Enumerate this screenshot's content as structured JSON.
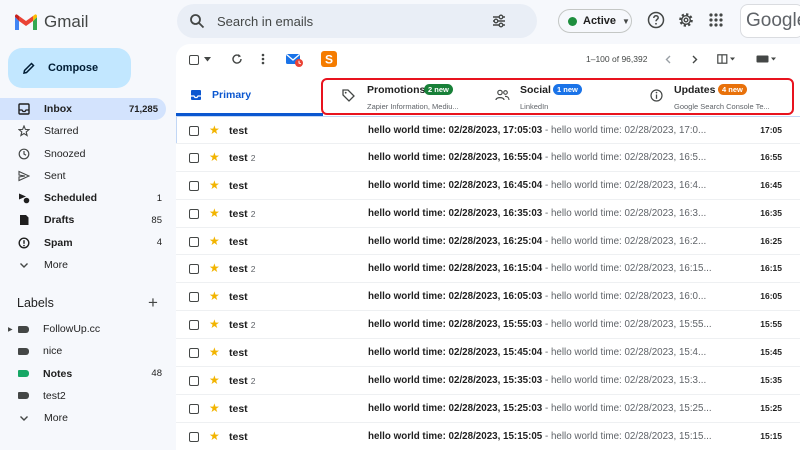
{
  "app": {
    "name": "Gmail"
  },
  "search": {
    "placeholder": "Search in emails"
  },
  "status": {
    "label": "Active"
  },
  "header": {
    "google_text": "Google"
  },
  "sidebar": {
    "compose_label": "Compose",
    "items": [
      {
        "label": "Inbox",
        "count": "71,285",
        "bold": true,
        "icon": "inbox-icon"
      },
      {
        "label": "Starred",
        "count": "",
        "bold": false,
        "icon": "star-icon"
      },
      {
        "label": "Snoozed",
        "count": "",
        "bold": false,
        "icon": "clock-icon"
      },
      {
        "label": "Sent",
        "count": "",
        "bold": false,
        "icon": "send-icon"
      },
      {
        "label": "Scheduled",
        "count": "1",
        "bold": true,
        "icon": "scheduled-icon"
      },
      {
        "label": "Drafts",
        "count": "85",
        "bold": true,
        "icon": "draft-icon"
      },
      {
        "label": "Spam",
        "count": "4",
        "bold": true,
        "icon": "spam-icon"
      },
      {
        "label": "More",
        "count": "",
        "bold": false,
        "icon": "chevron-down-icon"
      }
    ],
    "labels_heading": "Labels",
    "labels": [
      {
        "label": "FollowUp.cc",
        "count": "",
        "color": "#444746",
        "bold": false,
        "expander": true
      },
      {
        "label": "nice",
        "count": "",
        "color": "#444746",
        "bold": false,
        "expander": false
      },
      {
        "label": "Notes",
        "count": "48",
        "color": "#16a765",
        "bold": true,
        "expander": false
      },
      {
        "label": "test2",
        "count": "",
        "color": "#444746",
        "bold": false,
        "expander": false
      },
      {
        "label": "More",
        "count": "",
        "color": "",
        "bold": false,
        "expander": false
      }
    ]
  },
  "toolbar": {
    "pagination": "1–100 of 96,392"
  },
  "tabs": {
    "primary": "Primary",
    "promotions": {
      "name": "Promotions",
      "badge": "2 new",
      "sub": "Zapier Information, Mediu...",
      "color": "#188038"
    },
    "social": {
      "name": "Social",
      "badge": "1 new",
      "sub": "LinkedIn",
      "color": "#1a73e8"
    },
    "updates": {
      "name": "Updates",
      "badge": "4 new",
      "sub": "Google Search Console Te...",
      "color": "#e8710a"
    }
  },
  "emails": [
    {
      "sender": "test",
      "count": "",
      "subject": "hello world time: 02/28/2023, 17:05:03",
      "snippet": " - hello world time: 02/28/2023, 17:0...",
      "time": "17:05"
    },
    {
      "sender": "test",
      "count": "2",
      "subject": "hello world time: 02/28/2023, 16:55:04",
      "snippet": " - hello world time: 02/28/2023, 16:5...",
      "time": "16:55"
    },
    {
      "sender": "test",
      "count": "",
      "subject": "hello world time: 02/28/2023, 16:45:04",
      "snippet": " - hello world time: 02/28/2023, 16:4...",
      "time": "16:45"
    },
    {
      "sender": "test",
      "count": "2",
      "subject": "hello world time: 02/28/2023, 16:35:03",
      "snippet": " - hello world time: 02/28/2023, 16:3...",
      "time": "16:35"
    },
    {
      "sender": "test",
      "count": "",
      "subject": "hello world time: 02/28/2023, 16:25:04",
      "snippet": " - hello world time: 02/28/2023, 16:2...",
      "time": "16:25"
    },
    {
      "sender": "test",
      "count": "2",
      "subject": "hello world time: 02/28/2023, 16:15:04",
      "snippet": " - hello world time: 02/28/2023, 16:15...",
      "time": "16:15"
    },
    {
      "sender": "test",
      "count": "",
      "subject": "hello world time: 02/28/2023, 16:05:03",
      "snippet": " - hello world time: 02/28/2023, 16:0...",
      "time": "16:05"
    },
    {
      "sender": "test",
      "count": "2",
      "subject": "hello world time: 02/28/2023, 15:55:03",
      "snippet": " - hello world time: 02/28/2023, 15:55...",
      "time": "15:55"
    },
    {
      "sender": "test",
      "count": "",
      "subject": "hello world time: 02/28/2023, 15:45:04",
      "snippet": " - hello world time: 02/28/2023, 15:4...",
      "time": "15:45"
    },
    {
      "sender": "test",
      "count": "2",
      "subject": "hello world time: 02/28/2023, 15:35:03",
      "snippet": " - hello world time: 02/28/2023, 15:3...",
      "time": "15:35"
    },
    {
      "sender": "test",
      "count": "",
      "subject": "hello world time: 02/28/2023, 15:25:03",
      "snippet": " - hello world time: 02/28/2023, 15:25...",
      "time": "15:25"
    },
    {
      "sender": "test",
      "count": "",
      "subject": "hello world time: 02/28/2023, 15:15:05",
      "snippet": " - hello world time: 02/28/2023, 15:15...",
      "time": "15:15"
    }
  ],
  "colors": {
    "accent": "#0b57d0",
    "compose_bg": "#c2e7ff",
    "selected_bg": "#d3e3fd",
    "highlight_box": "#e8131e",
    "star": "#f2b400"
  }
}
